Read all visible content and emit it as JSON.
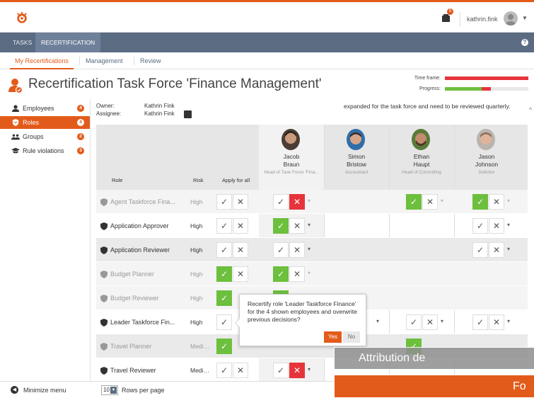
{
  "app": {
    "user_name": "kathrin.fink",
    "notification_count": "6",
    "brand_color": "#e35b1b"
  },
  "nav": {
    "tabs": [
      {
        "label": "TASKS"
      },
      {
        "label": "RECERTIFICATION"
      }
    ]
  },
  "subnav": {
    "tabs": [
      {
        "label": "My Recertifications"
      },
      {
        "label": "Management"
      },
      {
        "label": "Review"
      }
    ]
  },
  "header": {
    "title": "Recertification Task Force 'Finance Management'",
    "time_frame_label": "Time frame:",
    "progress_label": "Progress:",
    "time_frame_fraction": 1.0,
    "progress_green_fraction": 0.44,
    "progress_red_fraction": 0.11
  },
  "sidebar": {
    "items": [
      {
        "label": "Employees",
        "badge": "4",
        "icon": "person-icon"
      },
      {
        "label": "Roles",
        "badge": "4",
        "icon": "shield-icon"
      },
      {
        "label": "Groups",
        "badge": "2",
        "icon": "group-icon"
      },
      {
        "label": "Rule violations",
        "badge": "3",
        "icon": "graduation-cap-icon"
      }
    ]
  },
  "meta": {
    "owner_label": "Owner:",
    "owner_value": "Kathrin Fink",
    "assignee_label": "Assignee:",
    "assignee_value": "Kathrin Fink",
    "description": "expanded for the task force and need to be reviewed quarterly."
  },
  "table": {
    "col_role": "Role",
    "col_risk": "Risk",
    "col_apply": "Apply for all",
    "employees": [
      {
        "first": "Jacob",
        "last": "Braun",
        "title": "Head of Task Force 'Fina..."
      },
      {
        "first": "Simon",
        "last": "Bristow",
        "title": "Accountant"
      },
      {
        "first": "Ethan",
        "last": "Haupt",
        "title": "Head of Controlling"
      },
      {
        "first": "Jason",
        "last": "Johnson",
        "title": "Solicitor"
      }
    ],
    "rows": [
      {
        "role": "Agent Taskforce Fina...",
        "risk": "High"
      },
      {
        "role": "Application Approver",
        "risk": "High"
      },
      {
        "role": "Application Reviewer",
        "risk": "High"
      },
      {
        "role": "Budget Planner",
        "risk": "High"
      },
      {
        "role": "Budget Reviewer",
        "risk": "High"
      },
      {
        "role": "Leader Taskforce Fin...",
        "risk": "High"
      },
      {
        "role": "Travel Planner",
        "risk": "Mediu..."
      },
      {
        "role": "Travel Reviewer",
        "risk": "Mediu..."
      }
    ]
  },
  "popover": {
    "text": "Recertify role 'Leader Taskforce Finance' for the 4 shown employees and overwrite previous decisions?",
    "yes_label": "Yes",
    "no_label": "No"
  },
  "footer": {
    "minimize_label": "Minimize menu",
    "rows_per_page_value": "10",
    "rows_per_page_label": "Rows per page"
  },
  "overlay": {
    "attribution_text": "Attribution de",
    "bottom_text": "Fo"
  }
}
